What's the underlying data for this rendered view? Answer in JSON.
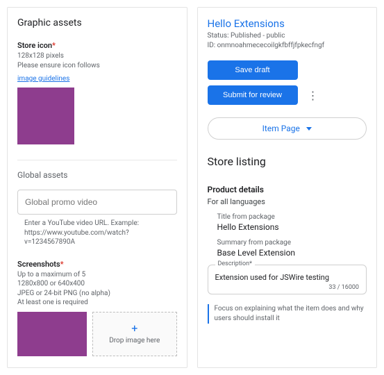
{
  "left": {
    "heading": "Graphic assets",
    "storeIcon": {
      "label": "Store icon",
      "required": "*",
      "dim": "128x128 pixels",
      "ensure": "Please ensure icon follows",
      "guidelines": "image guidelines",
      "color": "#8e3d8e"
    },
    "globalAssets": {
      "heading": "Global assets",
      "promoPlaceholder": "Global promo video",
      "promoHint": "Enter a YouTube video URL. Example: https://www.youtube.com/watch?v=1234567890A"
    },
    "screenshots": {
      "label": "Screenshots",
      "required": "*",
      "line1": "Up to a maximum of 5",
      "line2": "1280x800 or 640x400",
      "line3": "JPEG or 24-bit PNG (no alpha)",
      "line4": "At least one is required",
      "dropText": "Drop image here",
      "plus": "+"
    }
  },
  "right": {
    "title": "Hello Extensions",
    "status": "Status: Published - public",
    "idLine": "ID: onmnoahmececoilgkfbffjfpkecfngf",
    "saveDraft": "Save draft",
    "submit": "Submit for review",
    "moreDots": "⋮",
    "itemPage": "Item Page",
    "storeListing": "Store listing",
    "productDetails": "Product details",
    "forAll": "For all languages",
    "titleLabel": "Title from package",
    "titleValue": "Hello Extensions",
    "summaryLabel": "Summary from package",
    "summaryValue": "Base Level Extension",
    "descLegend": "Description*",
    "descValue": "Extension used for JSWire testing",
    "counter": "33 / 16000",
    "focusNote": "Focus on explaining what the item does and why users should install it"
  }
}
